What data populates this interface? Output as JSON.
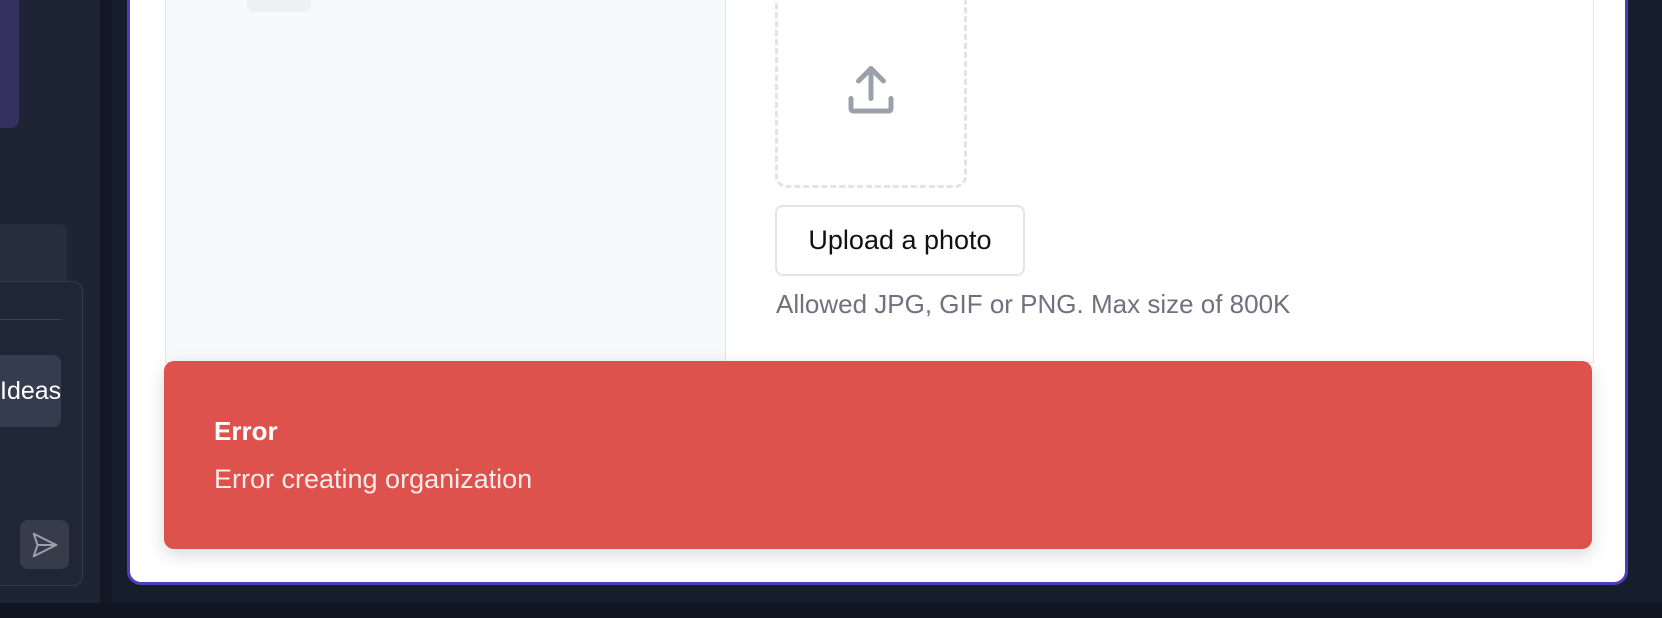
{
  "sidebar": {
    "chip_label": "Ideas",
    "send_icon": "send-icon"
  },
  "form": {
    "upload_icon": "upload-icon",
    "upload_button_label": "Upload a photo",
    "upload_hint": "Allowed JPG, GIF or PNG. Max size of 800K"
  },
  "toast": {
    "title": "Error",
    "message": "Error creating organization"
  },
  "colors": {
    "accent": "#4b3fbf",
    "error": "#de524d"
  }
}
